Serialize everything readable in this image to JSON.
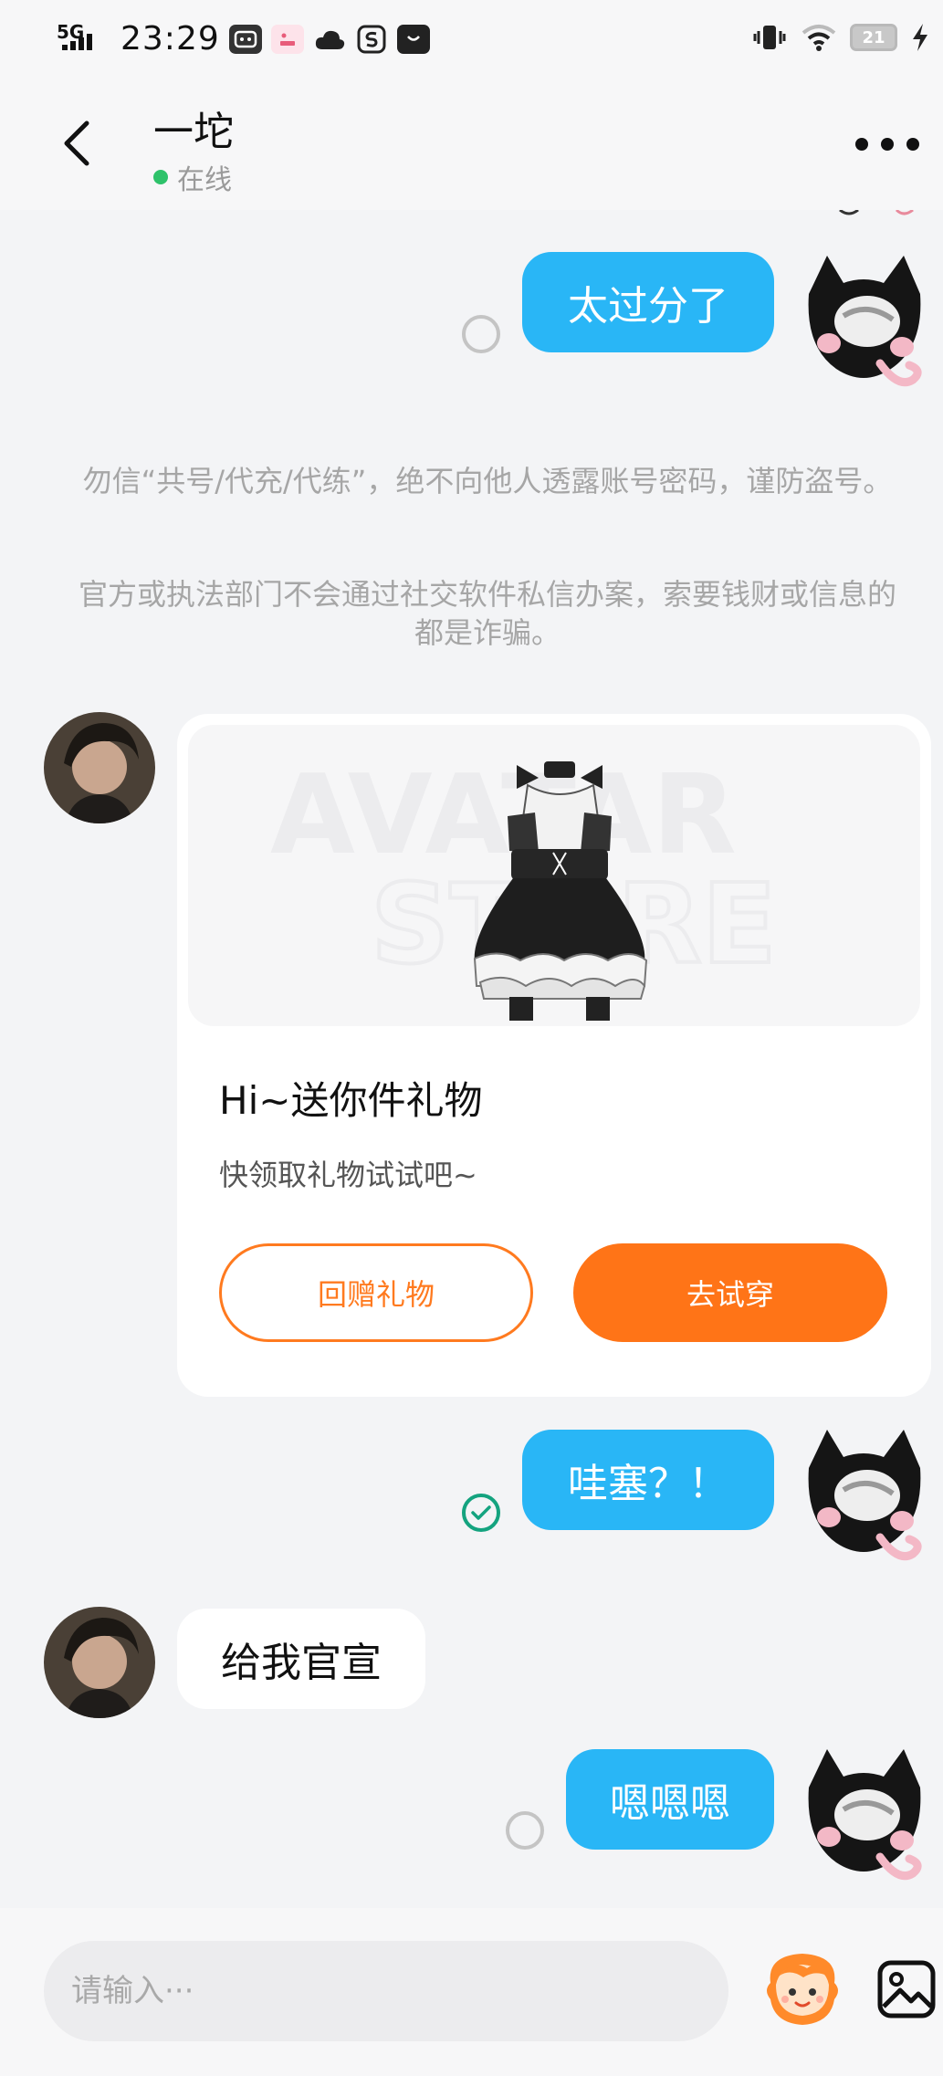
{
  "status_bar": {
    "network": "5G",
    "time": "23:29",
    "battery": "21"
  },
  "header": {
    "contact_name": "一坨",
    "presence": "在线"
  },
  "messages": {
    "m1": "太过分了",
    "m3": "哇塞？！",
    "m4": "给我官宣",
    "m5": "嗯嗯嗯"
  },
  "notice": {
    "line1": "勿信“共号/代充/代练”，绝不向他人透露账号密码，谨防盗号。",
    "line2": "官方或执法部门不会通过社交软件私信办案，索要钱财或信息的都是诈骗。"
  },
  "gift_card": {
    "watermark_top": "AVATAR",
    "watermark_bottom": "STORE",
    "title": "Hi~送你件礼物",
    "subtitle": "快领取礼物试试吧~",
    "return_button": "回赠礼物",
    "try_button": "去试穿"
  },
  "composer": {
    "placeholder": "请输入···"
  },
  "colors": {
    "outgoing_bubble": "#29b6f6",
    "accent_orange": "#ff7417",
    "online_green": "#2ec26a",
    "read_check": "#14a37f"
  },
  "icons": [
    "back-arrow-icon",
    "more-icon",
    "sticker-icon",
    "image-icon",
    "vibrate-icon",
    "wifi-icon",
    "battery-icon",
    "charging-icon"
  ]
}
